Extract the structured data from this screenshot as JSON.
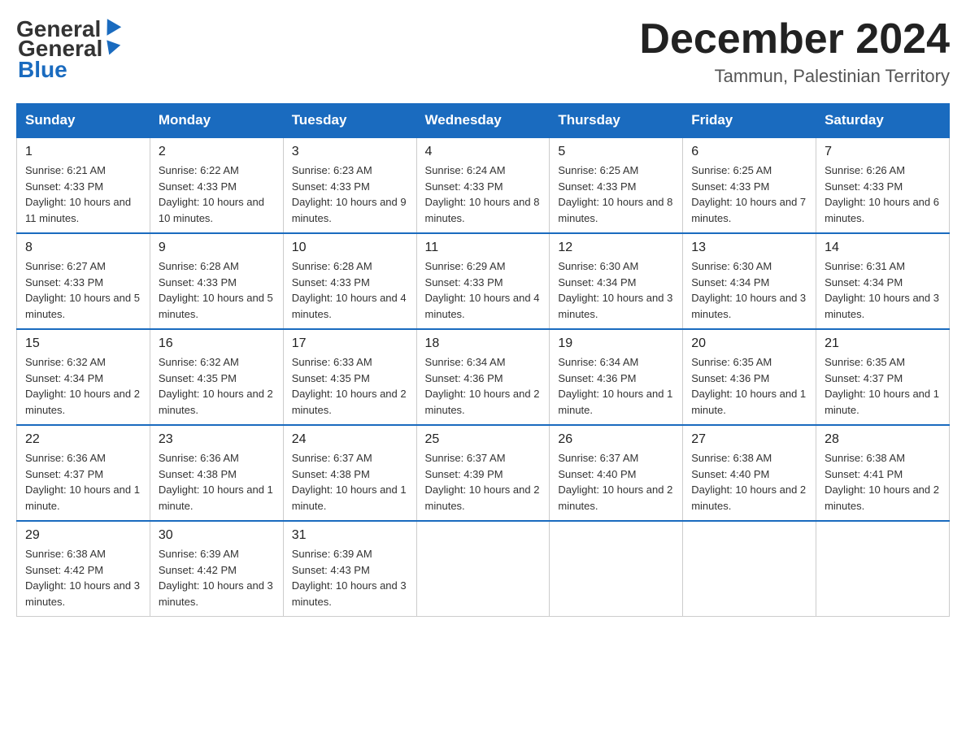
{
  "logo": {
    "text_general": "General",
    "text_blue": "Blue"
  },
  "header": {
    "month_title": "December 2024",
    "location": "Tammun, Palestinian Territory"
  },
  "weekdays": [
    "Sunday",
    "Monday",
    "Tuesday",
    "Wednesday",
    "Thursday",
    "Friday",
    "Saturday"
  ],
  "weeks": [
    [
      {
        "day": "1",
        "sunrise": "6:21 AM",
        "sunset": "4:33 PM",
        "daylight": "10 hours and 11 minutes."
      },
      {
        "day": "2",
        "sunrise": "6:22 AM",
        "sunset": "4:33 PM",
        "daylight": "10 hours and 10 minutes."
      },
      {
        "day": "3",
        "sunrise": "6:23 AM",
        "sunset": "4:33 PM",
        "daylight": "10 hours and 9 minutes."
      },
      {
        "day": "4",
        "sunrise": "6:24 AM",
        "sunset": "4:33 PM",
        "daylight": "10 hours and 8 minutes."
      },
      {
        "day": "5",
        "sunrise": "6:25 AM",
        "sunset": "4:33 PM",
        "daylight": "10 hours and 8 minutes."
      },
      {
        "day": "6",
        "sunrise": "6:25 AM",
        "sunset": "4:33 PM",
        "daylight": "10 hours and 7 minutes."
      },
      {
        "day": "7",
        "sunrise": "6:26 AM",
        "sunset": "4:33 PM",
        "daylight": "10 hours and 6 minutes."
      }
    ],
    [
      {
        "day": "8",
        "sunrise": "6:27 AM",
        "sunset": "4:33 PM",
        "daylight": "10 hours and 5 minutes."
      },
      {
        "day": "9",
        "sunrise": "6:28 AM",
        "sunset": "4:33 PM",
        "daylight": "10 hours and 5 minutes."
      },
      {
        "day": "10",
        "sunrise": "6:28 AM",
        "sunset": "4:33 PM",
        "daylight": "10 hours and 4 minutes."
      },
      {
        "day": "11",
        "sunrise": "6:29 AM",
        "sunset": "4:33 PM",
        "daylight": "10 hours and 4 minutes."
      },
      {
        "day": "12",
        "sunrise": "6:30 AM",
        "sunset": "4:34 PM",
        "daylight": "10 hours and 3 minutes."
      },
      {
        "day": "13",
        "sunrise": "6:30 AM",
        "sunset": "4:34 PM",
        "daylight": "10 hours and 3 minutes."
      },
      {
        "day": "14",
        "sunrise": "6:31 AM",
        "sunset": "4:34 PM",
        "daylight": "10 hours and 3 minutes."
      }
    ],
    [
      {
        "day": "15",
        "sunrise": "6:32 AM",
        "sunset": "4:34 PM",
        "daylight": "10 hours and 2 minutes."
      },
      {
        "day": "16",
        "sunrise": "6:32 AM",
        "sunset": "4:35 PM",
        "daylight": "10 hours and 2 minutes."
      },
      {
        "day": "17",
        "sunrise": "6:33 AM",
        "sunset": "4:35 PM",
        "daylight": "10 hours and 2 minutes."
      },
      {
        "day": "18",
        "sunrise": "6:34 AM",
        "sunset": "4:36 PM",
        "daylight": "10 hours and 2 minutes."
      },
      {
        "day": "19",
        "sunrise": "6:34 AM",
        "sunset": "4:36 PM",
        "daylight": "10 hours and 1 minute."
      },
      {
        "day": "20",
        "sunrise": "6:35 AM",
        "sunset": "4:36 PM",
        "daylight": "10 hours and 1 minute."
      },
      {
        "day": "21",
        "sunrise": "6:35 AM",
        "sunset": "4:37 PM",
        "daylight": "10 hours and 1 minute."
      }
    ],
    [
      {
        "day": "22",
        "sunrise": "6:36 AM",
        "sunset": "4:37 PM",
        "daylight": "10 hours and 1 minute."
      },
      {
        "day": "23",
        "sunrise": "6:36 AM",
        "sunset": "4:38 PM",
        "daylight": "10 hours and 1 minute."
      },
      {
        "day": "24",
        "sunrise": "6:37 AM",
        "sunset": "4:38 PM",
        "daylight": "10 hours and 1 minute."
      },
      {
        "day": "25",
        "sunrise": "6:37 AM",
        "sunset": "4:39 PM",
        "daylight": "10 hours and 2 minutes."
      },
      {
        "day": "26",
        "sunrise": "6:37 AM",
        "sunset": "4:40 PM",
        "daylight": "10 hours and 2 minutes."
      },
      {
        "day": "27",
        "sunrise": "6:38 AM",
        "sunset": "4:40 PM",
        "daylight": "10 hours and 2 minutes."
      },
      {
        "day": "28",
        "sunrise": "6:38 AM",
        "sunset": "4:41 PM",
        "daylight": "10 hours and 2 minutes."
      }
    ],
    [
      {
        "day": "29",
        "sunrise": "6:38 AM",
        "sunset": "4:42 PM",
        "daylight": "10 hours and 3 minutes."
      },
      {
        "day": "30",
        "sunrise": "6:39 AM",
        "sunset": "4:42 PM",
        "daylight": "10 hours and 3 minutes."
      },
      {
        "day": "31",
        "sunrise": "6:39 AM",
        "sunset": "4:43 PM",
        "daylight": "10 hours and 3 minutes."
      },
      null,
      null,
      null,
      null
    ]
  ]
}
